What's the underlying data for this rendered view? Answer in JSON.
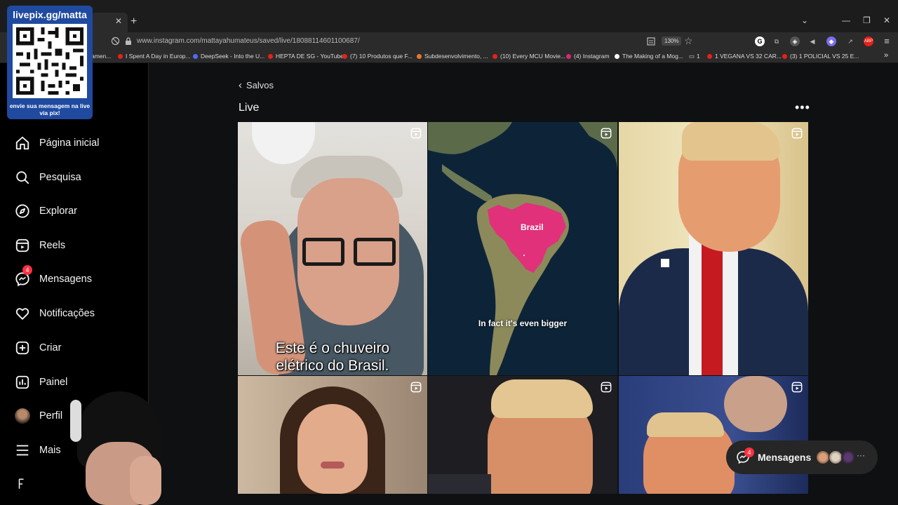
{
  "browser": {
    "url": "www.instagram.com/mattayahumateus/saved/live/18088114601100687/",
    "zoom": "130%",
    "bookmarks": [
      "amen...",
      "I Spent A Day in Europ...",
      "DeepSeek - Into the U...",
      "HEPTA DE SG - YouTube",
      "(7) 10 Produtos que F...",
      "Subdesenvolvimento, ...",
      "(10) Every MCU Movie...",
      "(4) Instagram",
      "The Making of a Mog...",
      "1",
      "1 VEGANA VS 32 CAR...",
      "(3) 1 POLICIAL VS 25 E..."
    ]
  },
  "overlay": {
    "qr_title": "livepix.gg/matta",
    "qr_caption": "envie sua mensagem na live via pix!"
  },
  "sidebar": {
    "items": [
      {
        "label": "Página inicial",
        "icon": "home-icon"
      },
      {
        "label": "Pesquisa",
        "icon": "search-icon"
      },
      {
        "label": "Explorar",
        "icon": "compass-icon"
      },
      {
        "label": "Reels",
        "icon": "reels-icon"
      },
      {
        "label": "Mensagens",
        "icon": "messenger-icon",
        "badge": "4"
      },
      {
        "label": "Notificações",
        "icon": "heart-icon"
      },
      {
        "label": "Criar",
        "icon": "plus-square-icon"
      },
      {
        "label": "Painel",
        "icon": "chart-icon"
      },
      {
        "label": "Perfil",
        "icon": "avatar-icon"
      },
      {
        "label": "Mais",
        "icon": "menu-icon"
      }
    ]
  },
  "main": {
    "back_label": "Salvos",
    "title": "Live",
    "tiles": [
      {
        "caption": "Este é o chuveiro elétrico do Brasil.",
        "caption_line1": "Este é o chuveiro",
        "caption_line2": "elétrico do Brasil."
      },
      {
        "map_label": "Brazil",
        "caption": "In fact it's even bigger"
      },
      {},
      {},
      {},
      {}
    ]
  },
  "messages_pill": {
    "label": "Mensagens",
    "badge": "4"
  },
  "colors": {
    "accent_red": "#ff3040",
    "page_bg": "#0e1012",
    "map_pink": "#e0317a"
  }
}
